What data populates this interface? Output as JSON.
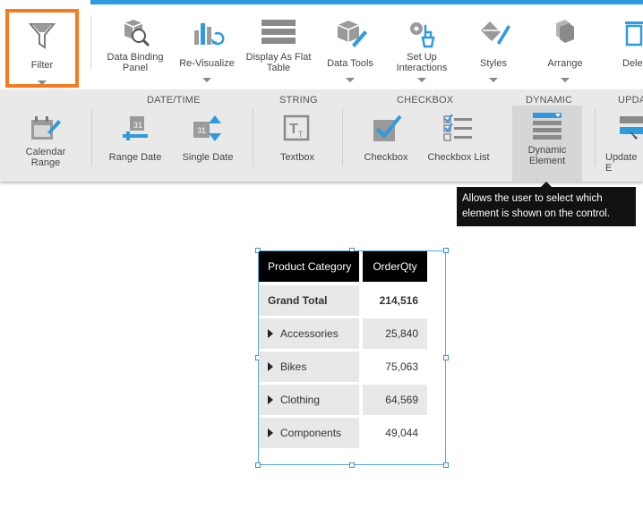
{
  "toolbar": {
    "filter": "Filter",
    "data_binding": [
      "Data Binding",
      "Panel"
    ],
    "revisualize": "Re-Visualize",
    "flat_table": [
      "Display As Flat",
      "Table"
    ],
    "data_tools": "Data Tools",
    "interactions": [
      "Set Up",
      "Interactions"
    ],
    "styles": "Styles",
    "arrange": "Arrange",
    "delete": "Dele"
  },
  "sections": {
    "datetime": "DATE/TIME",
    "string": "STRING",
    "checkbox": "CHECKBOX",
    "dynamic": "DYNAMIC",
    "update": "UPDA"
  },
  "filters": {
    "calendar_range": [
      "Calendar",
      "Range"
    ],
    "range_date": "Range Date",
    "single_date": "Single Date",
    "textbox": "Textbox",
    "checkbox": "Checkbox",
    "checkbox_list": "Checkbox List",
    "dynamic_element": [
      "Dynamic",
      "Element"
    ],
    "update": "Update E"
  },
  "tooltip": "Allows the user to select which element is shown on the control.",
  "table": {
    "headers": [
      "Product Category",
      "OrderQty"
    ],
    "grand_total": {
      "label": "Grand Total",
      "value": "214,516"
    },
    "rows": [
      {
        "label": "Accessories",
        "value": "25,840"
      },
      {
        "label": "Bikes",
        "value": "75,063"
      },
      {
        "label": "Clothing",
        "value": "64,569"
      },
      {
        "label": "Components",
        "value": "49,044"
      }
    ]
  },
  "colors": {
    "accent": "#2e9ae0",
    "highlight": "#f47b20",
    "icon": "#8a8a8a"
  }
}
